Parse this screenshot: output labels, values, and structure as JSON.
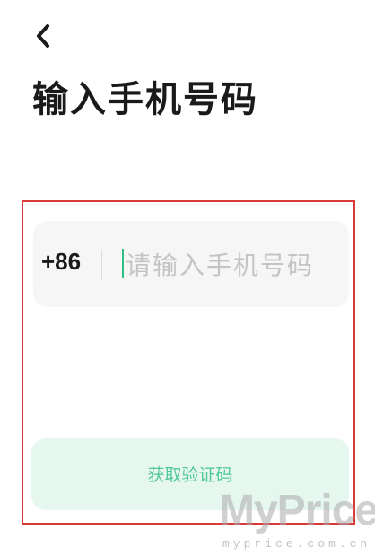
{
  "header": {
    "back_icon": "chevron-left-icon",
    "title": "输入手机号码"
  },
  "form": {
    "country_code": "+86",
    "phone_placeholder": "请输入手机号码",
    "phone_value": "",
    "submit_label": "获取验证码"
  },
  "watermark": {
    "logo": "MyPrice",
    "url": "myprice.com.cn"
  },
  "colors": {
    "accent": "#2fbf85",
    "button_bg": "#e6f7ef",
    "button_text": "#52c896",
    "highlight_border": "#d83a3a",
    "input_bg": "#f6f6f6"
  }
}
